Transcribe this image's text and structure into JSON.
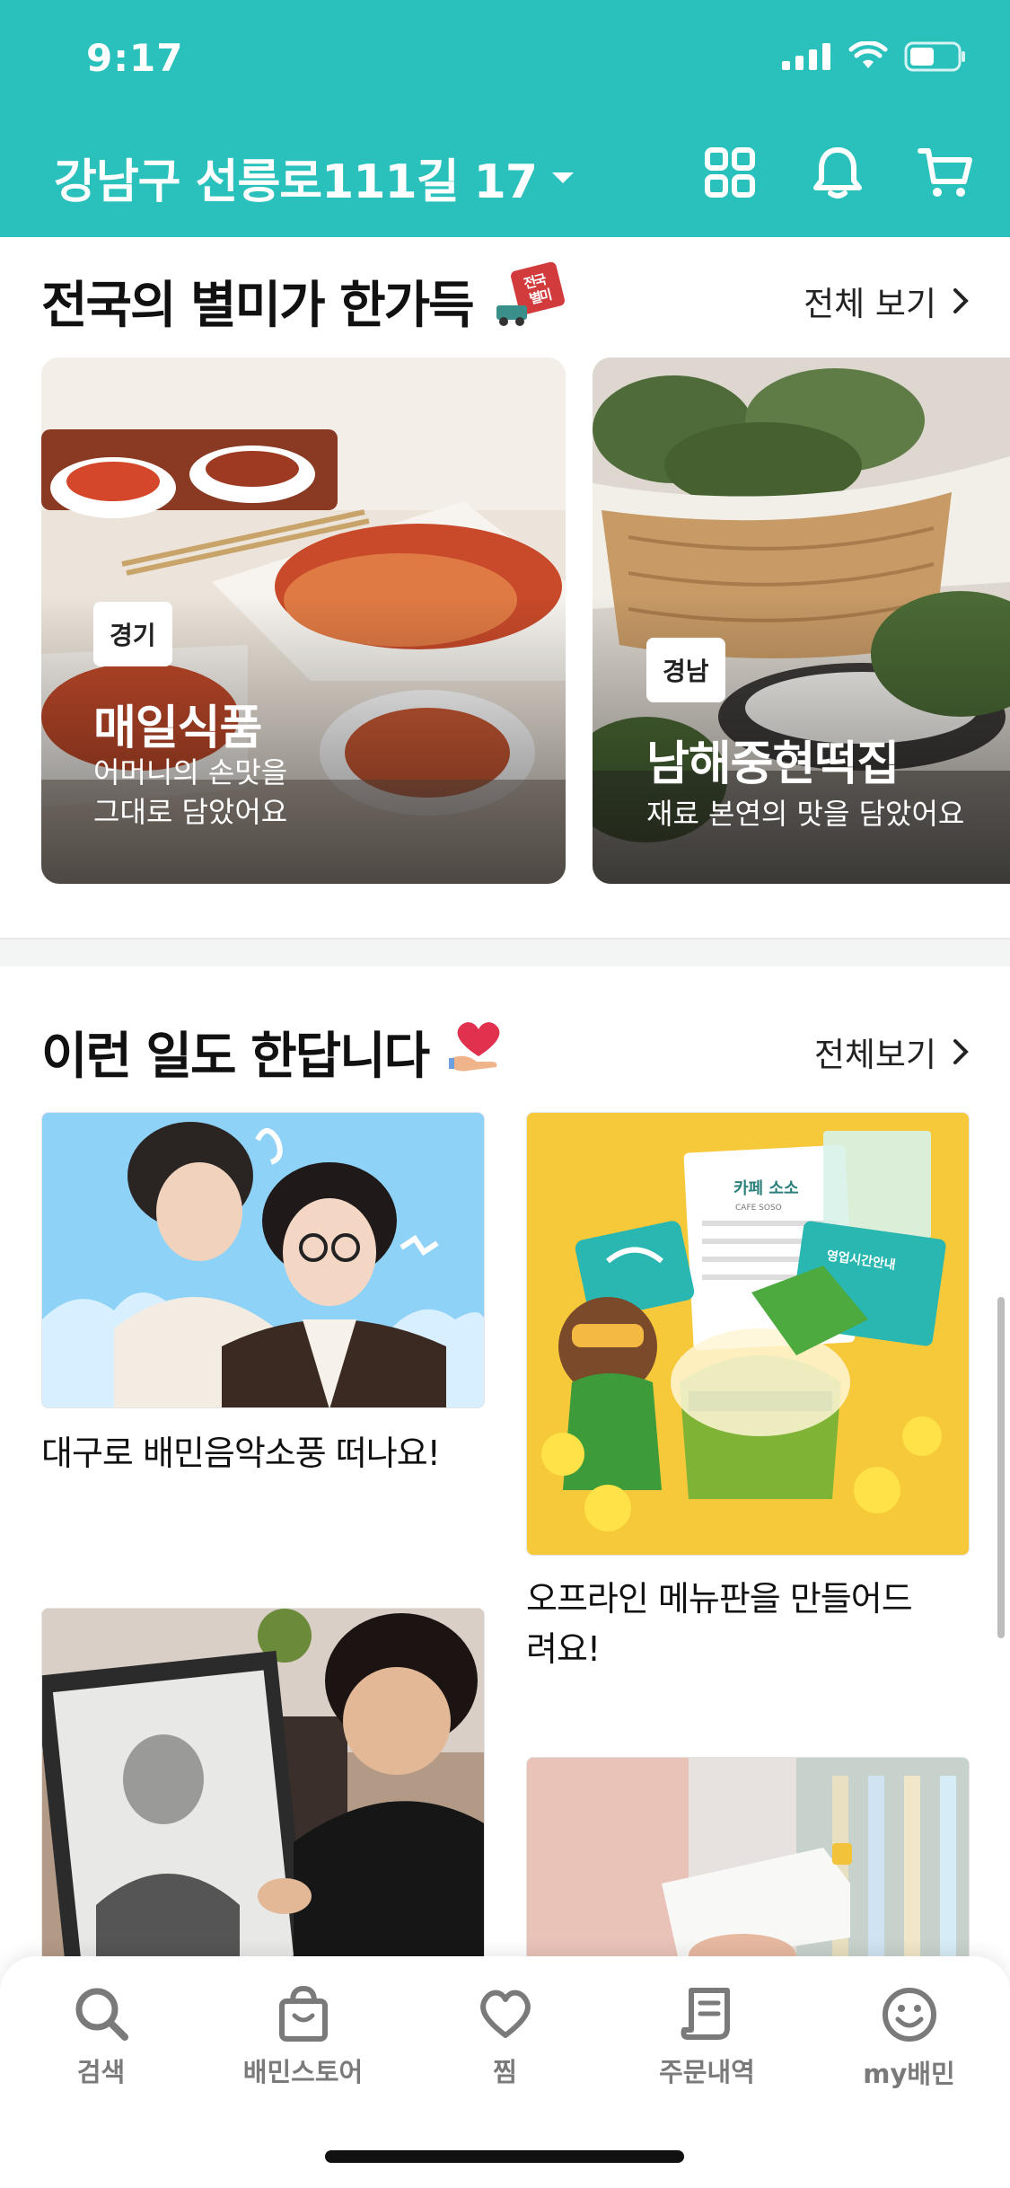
{
  "status_bar": {
    "time": "9:17"
  },
  "header": {
    "address": "강남구 선릉로111길 17"
  },
  "section_local": {
    "title": "전국의 별미가 한가득",
    "badge_text": "전국 별미",
    "see_all": "전체 보기",
    "cards": [
      {
        "region": "경기",
        "name": "매일식품",
        "desc_line1": "어머니의 손맛을",
        "desc_line2": "그대로 담았어요"
      },
      {
        "region": "경남",
        "name": "남해중현떡집",
        "desc_line1": "재료 본연의 맛을 담았어요"
      }
    ]
  },
  "section_stories": {
    "title": "이런 일도 한답니다",
    "see_all": "전체보기",
    "items": [
      {
        "caption": "대구로 배민음악소풍 떠나요!"
      },
      {
        "caption_line1": "오프라인 메뉴판을 만들어드",
        "caption_line2": "려요!"
      },
      {
        "caption": ""
      },
      {
        "caption": ""
      }
    ],
    "menu_board": {
      "title": "카페 소소",
      "sub": "CAFE SOSO",
      "tag": "영업시간안내"
    }
  },
  "tabbar": {
    "tabs": [
      {
        "label": "검색",
        "icon": "search-icon"
      },
      {
        "label": "배민스토어",
        "icon": "shopping-bag-icon"
      },
      {
        "label": "찜",
        "icon": "heart-icon"
      },
      {
        "label": "주문내역",
        "icon": "receipt-icon"
      },
      {
        "label": "my배민",
        "icon": "smile-face-icon"
      }
    ]
  },
  "colors": {
    "brand": "#2ac1bc",
    "tab_inactive": "#7a7a7a"
  }
}
